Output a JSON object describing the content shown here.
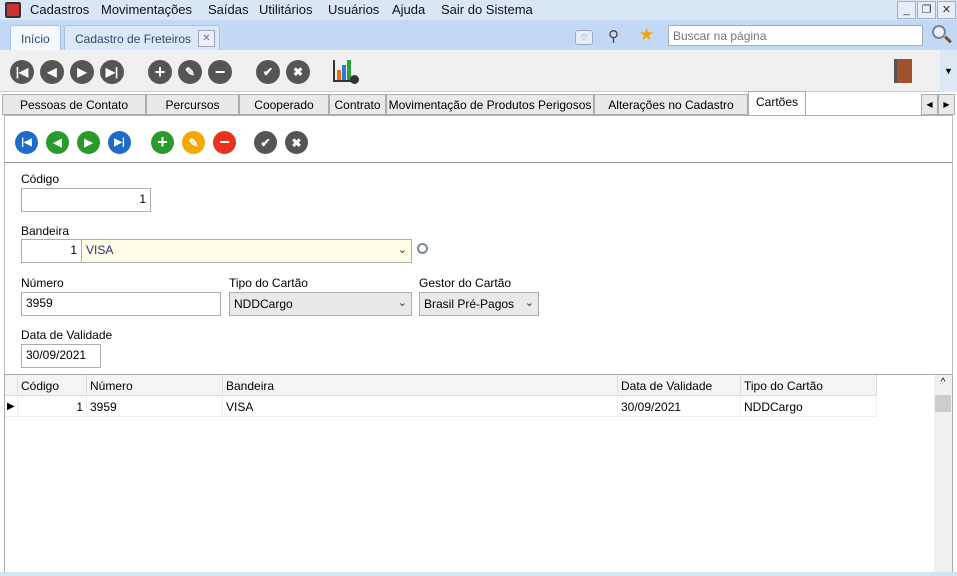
{
  "menu": [
    "Cadastros",
    "Movimentações",
    "Saídas",
    "Utilitários",
    "Usuários",
    "Ajuda",
    "Sair do Sistema"
  ],
  "window_buttons": {
    "minimize": "_",
    "restore": "❐",
    "close": "✕"
  },
  "doc_tabs": [
    {
      "label": "Início"
    },
    {
      "label": "Cadastro de Freteiros",
      "active": true
    }
  ],
  "search": {
    "placeholder": "Buscar na página"
  },
  "page_tabs": [
    "Pessoas de Contato",
    "Percursos",
    "Cooperado",
    "Contrato",
    "Movimentação de Produtos Perigosos",
    "Alterações no Cadastro",
    "Cartões"
  ],
  "active_page_tab": "Cartões",
  "form": {
    "codigo": {
      "label": "Código",
      "value": "1"
    },
    "bandeira": {
      "label": "Bandeira",
      "code": "1",
      "value": "VISA"
    },
    "numero": {
      "label": "Número",
      "value": "3959"
    },
    "tipo": {
      "label": "Tipo do Cartão",
      "value": "NDDCargo"
    },
    "gestor": {
      "label": "Gestor do Cartão",
      "value": "Brasil Pré-Pagos"
    },
    "validade": {
      "label": "Data de Validade",
      "value": "30/09/2021"
    }
  },
  "grid": {
    "columns": [
      "Código",
      "Número",
      "Bandeira",
      "Data de Validade",
      "Tipo do Cartão"
    ],
    "rows": [
      [
        "1",
        "3959",
        "VISA",
        "30/09/2021",
        "NDDCargo"
      ]
    ]
  },
  "colors": {
    "nav_blue": "#1e6cc8",
    "nav_green": "#2a9a2a",
    "add": "#2a9a2a",
    "edit": "#f5a800",
    "delete": "#e8321e",
    "gray": "#555555"
  }
}
